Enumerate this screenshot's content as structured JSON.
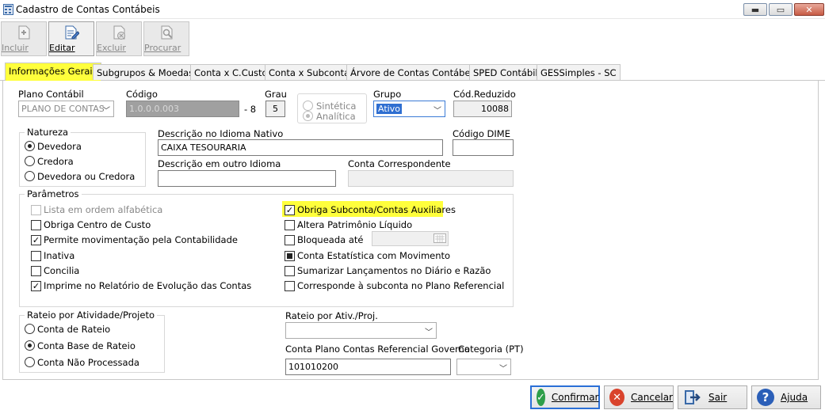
{
  "window": {
    "title": "Cadastro de Contas Contábeis",
    "min": "▬",
    "max": "▭",
    "close": "✕"
  },
  "toolbar": [
    {
      "label": "Incluir",
      "icon": "new-doc-icon",
      "enabled": false
    },
    {
      "label": "Editar",
      "icon": "edit-doc-icon",
      "enabled": true
    },
    {
      "label": "Excluir",
      "icon": "delete-doc-icon",
      "enabled": false
    },
    {
      "label": "Procurar",
      "icon": "search-doc-icon",
      "enabled": false
    }
  ],
  "tabs": [
    "Informações Gerais",
    "Subgrupos & Moedas",
    "Conta x C.Custo",
    "Conta x Subconta",
    "Árvore de Contas Contábeis",
    "SPED Contábil",
    "GESSimples - SC"
  ],
  "form": {
    "plano_label": "Plano Contábil",
    "plano_value": "PLANO DE CONTAS",
    "codigo_label": "Código",
    "codigo_value": "1.0.0.0.003",
    "codigo_suffix": "- 8",
    "grau_label": "Grau",
    "grau_value": "5",
    "sintetica": "Sintética",
    "analitica": "Analítica",
    "grupo_label": "Grupo",
    "grupo_value": "Ativo",
    "codred_label": "Cód.Reduzido",
    "codred_value": "10088",
    "natureza_label": "Natureza",
    "natureza": [
      "Devedora",
      "Credora",
      "Devedora ou Credora"
    ],
    "desc_nativo_label": "Descrição no Idioma Nativo",
    "desc_nativo_value": "CAIXA TESOURARIA",
    "dime_label": "Código DIME",
    "dime_value": "",
    "desc_outro_label": "Descrição em outro Idioma",
    "desc_outro_value": "",
    "conta_corr_label": "Conta Correspondente",
    "conta_corr_value": "",
    "parametros_label": "Parâmetros",
    "params_left": [
      "Lista em ordem alfabética",
      "Obriga Centro de Custo",
      "Permite movimentação pela Contabilidade",
      "Inativa",
      "Concilia",
      "Imprime no Relatório de Evolução das Contas"
    ],
    "params_right": [
      "Obriga Subconta/Contas Auxiliares",
      "Altera Patrimônio Líquido",
      "Bloqueada até",
      "Conta Estatística com Movimento",
      "Sumarizar Lançamentos no Diário e Razão",
      "Corresponde à subconta no Plano Referencial"
    ],
    "rateio_label": "Rateio por Atividade/Projeto",
    "rateio": [
      "Conta de Rateio",
      "Conta Base de Rateio",
      "Conta Não Processada"
    ],
    "rateio_ativ_label": "Rateio por Ativ./Proj.",
    "rateio_ativ_value": "",
    "conta_ref_label": "Conta Plano Contas Referencial Governo",
    "conta_ref_value": "101010200",
    "categoria_label": "Categoria (PT)",
    "categoria_value": ""
  },
  "buttons": {
    "confirmar": "Confirmar",
    "cancelar": "Cancelar",
    "sair": "Sair",
    "ajuda": "Ajuda"
  },
  "colors": {
    "highlight": "#ffff3c",
    "default_border": "#2a6fd6",
    "confirm": "#2e9e4a",
    "cancel": "#d9432c",
    "help": "#2b5fb8"
  }
}
